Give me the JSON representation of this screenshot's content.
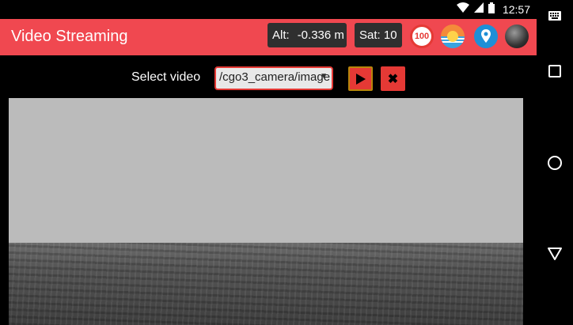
{
  "status_bar": {
    "time": "12:57"
  },
  "app_bar": {
    "title": "Video Streaming",
    "alt_label": "Alt:",
    "alt_value": "-0.336 m",
    "sat_label": "Sat: 10",
    "battery_value": "100",
    "accent_color": "#f04850"
  },
  "toolbar": {
    "select_label": "Select video",
    "selected_video": "/cgo3_camera/image"
  },
  "icons": [
    "wifi-icon",
    "signal-icon",
    "battery-icon",
    "keyboard-icon",
    "recents-icon",
    "home-icon",
    "back-icon",
    "play-icon",
    "stop-icon",
    "location-icon"
  ]
}
